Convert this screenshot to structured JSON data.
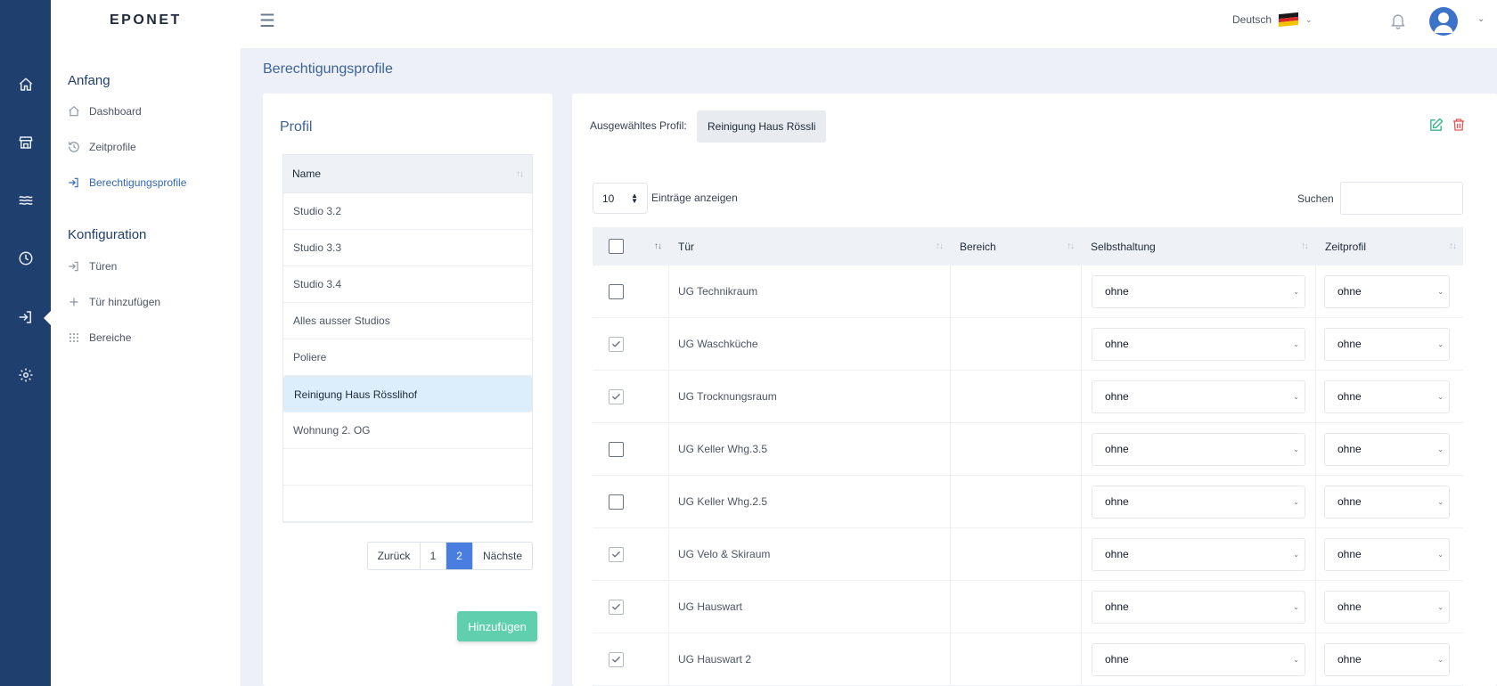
{
  "header": {
    "logo": "EPONET",
    "language": "Deutsch"
  },
  "colors": {
    "rail": "#1f3f6e",
    "accent": "#4a7de0",
    "add_button": "#5fcfae",
    "selected_row": "#dcedfb",
    "delete": "#e05a5a",
    "edit": "#3ab58a"
  },
  "rail_icons": [
    "home-icon",
    "store-icon",
    "waves-icon",
    "clock-icon",
    "sign-in-icon",
    "gear-icon"
  ],
  "sidebar": {
    "section1": "Anfang",
    "section2": "Konfiguration",
    "items": [
      {
        "label": "Dashboard",
        "icon": "home-icon"
      },
      {
        "label": "Zeitprofile",
        "icon": "history-icon"
      },
      {
        "label": "Berechtigungsprofile",
        "icon": "sign-in-icon"
      },
      {
        "label": "Türen",
        "icon": "sign-in-icon"
      },
      {
        "label": "Tür hinzufügen",
        "icon": "plus-icon"
      },
      {
        "label": "Bereiche",
        "icon": "grid-icon"
      }
    ]
  },
  "page": {
    "title": "Berechtigungsprofile"
  },
  "profile_card": {
    "title": "Profil",
    "column": "Name",
    "rows": [
      "Studio 3.2",
      "Studio 3.3",
      "Studio 3.4",
      "Alles ausser Studios",
      "Poliere",
      "Reinigung Haus Rösslihof",
      "Wohnung 2. OG",
      "",
      ""
    ],
    "selected_index": 5,
    "pagination": {
      "prev": "Zurück",
      "p1": "1",
      "p2": "2",
      "next": "Nächste",
      "current": 2
    },
    "add_button": "Hinzufügen"
  },
  "detail_card": {
    "selected_label": "Ausgewähltes Profil:",
    "selected_value": "Reinigung Haus Rössli",
    "page_length": "10",
    "page_length_label": "Einträge anzeigen",
    "search_label": "Suchen",
    "search_value": "",
    "columns": {
      "tur": "Tür",
      "bereich": "Bereich",
      "selbst": "Selbsthaltung",
      "zeit": "Zeitprofil"
    },
    "rows": [
      {
        "checked": false,
        "tur": "UG Technikraum",
        "bereich": "",
        "selbst": "ohne",
        "zeit": "ohne"
      },
      {
        "checked": true,
        "tur": "UG Waschküche",
        "bereich": "",
        "selbst": "ohne",
        "zeit": "ohne"
      },
      {
        "checked": true,
        "tur": "UG Trocknungsraum",
        "bereich": "",
        "selbst": "ohne",
        "zeit": "ohne"
      },
      {
        "checked": false,
        "tur": "UG Keller Whg.3.5",
        "bereich": "",
        "selbst": "ohne",
        "zeit": "ohne"
      },
      {
        "checked": false,
        "tur": "UG Keller Whg.2.5",
        "bereich": "",
        "selbst": "ohne",
        "zeit": "ohne"
      },
      {
        "checked": true,
        "tur": "UG Velo & Skiraum",
        "bereich": "",
        "selbst": "ohne",
        "zeit": "ohne"
      },
      {
        "checked": true,
        "tur": "UG Hauswart",
        "bereich": "",
        "selbst": "ohne",
        "zeit": "ohne"
      },
      {
        "checked": true,
        "tur": "UG Hauswart 2",
        "bereich": "",
        "selbst": "ohne",
        "zeit": "ohne"
      }
    ]
  }
}
